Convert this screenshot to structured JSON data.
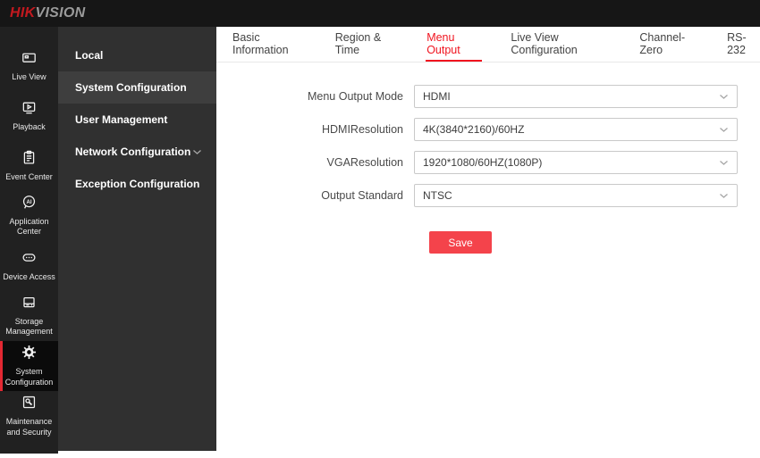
{
  "topbar": {
    "logo_hik": "HIK",
    "logo_vision": "VISION"
  },
  "iconbar": {
    "items": [
      {
        "label": "Live View",
        "active": false
      },
      {
        "label": "Playback",
        "active": false
      },
      {
        "label": "Event Center",
        "active": false
      },
      {
        "label": "Application Center",
        "active": false
      },
      {
        "label": "Device Access",
        "active": false
      },
      {
        "label": "Storage Management",
        "active": false
      },
      {
        "label": "System Configuration",
        "active": true
      },
      {
        "label": "Maintenance and Security",
        "active": false
      }
    ]
  },
  "subnav": {
    "items": [
      {
        "label": "Local",
        "active": false
      },
      {
        "label": "System Configuration",
        "active": true
      },
      {
        "label": "User Management",
        "active": false
      },
      {
        "label": "Network Configuration",
        "active": false,
        "expandable": true
      },
      {
        "label": "Exception Configuration",
        "active": false
      }
    ]
  },
  "tabs": [
    {
      "label": "Basic Information",
      "active": false
    },
    {
      "label": "Region & Time",
      "active": false
    },
    {
      "label": "Menu Output",
      "active": true
    },
    {
      "label": "Live View Configuration",
      "active": false
    },
    {
      "label": "Channel-Zero",
      "active": false
    },
    {
      "label": "RS-232",
      "active": false
    }
  ],
  "form": {
    "fields": [
      {
        "label": "Menu Output Mode",
        "value": "HDMI"
      },
      {
        "label": "HDMIResolution",
        "value": "4K(3840*2160)/60HZ"
      },
      {
        "label": "VGAResolution",
        "value": "1920*1080/60HZ(1080P)"
      },
      {
        "label": "Output Standard",
        "value": "NTSC"
      }
    ],
    "save_label": "Save"
  },
  "colors": {
    "topbar_bg": "#161616",
    "iconbar_bg": "#212121",
    "subnav_bg": "#303030",
    "active_item_bg": "#0b0b0b",
    "active_band_bg": "#3e3e3e",
    "accent_red": "#e32832",
    "active_tab_red": "#f0141f",
    "save_button_red": "#f4434b",
    "logo_red": "#c2191f",
    "logo_gray": "#9a9a9a"
  }
}
